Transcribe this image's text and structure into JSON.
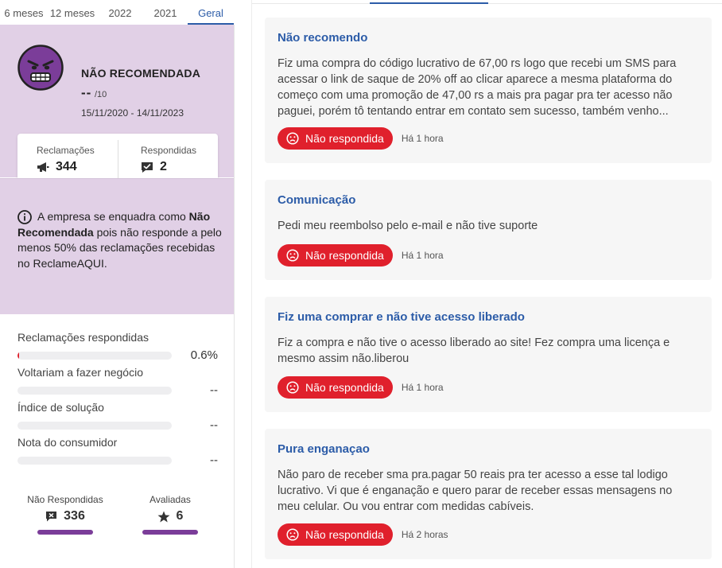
{
  "tabs": [
    "6 meses",
    "12 meses",
    "2022",
    "2021",
    "Geral"
  ],
  "status": {
    "title": "NÃO RECOMENDADA",
    "score": "--",
    "score_max": "/10",
    "period": "15/11/2020 - 14/11/2023"
  },
  "counts": {
    "reclamacoes_label": "Reclamações",
    "reclamacoes_value": "344",
    "respondidas_label": "Respondidas",
    "respondidas_value": "2"
  },
  "info": {
    "text_before": "A empresa se enquadra como ",
    "text_bold": "Não Recomendada",
    "text_after": " pois não responde a pelo menos 50% das reclamações recebidas no ReclameAQUI."
  },
  "metrics": [
    {
      "label": "Reclamações respondidas",
      "value": "0.6%",
      "fill": 0.006
    },
    {
      "label": "Voltariam a fazer negócio",
      "value": "--",
      "fill": 0
    },
    {
      "label": "Índice de solução",
      "value": "--",
      "fill": 0
    },
    {
      "label": "Nota do consumidor",
      "value": "--",
      "fill": 0
    }
  ],
  "bottom": {
    "nao_respondidas_label": "Não Respondidas",
    "nao_respondidas_value": "336",
    "avaliadas_label": "Avaliadas",
    "avaliadas_value": "6"
  },
  "complaints": [
    {
      "title": "Não recomendo",
      "body": "Fiz uma compra do código lucrativo de 67,00 rs logo que recebi um SMS para acessar o link de saque de 20% off ao clicar aparece a mesma plataforma do começo com uma promoção de 47,00 rs a mais pra pagar pra ter acesso não paguei, porém tô tentando entrar em contato sem sucesso, também venho...",
      "status": "Não respondida",
      "time": "Há 1 hora"
    },
    {
      "title": "Comunicação",
      "body": "Pedi meu reembolso pelo e-mail e não tive suporte",
      "status": "Não respondida",
      "time": "Há 1 hora"
    },
    {
      "title": "Fiz uma comprar e não tive acesso liberado",
      "body": "Fiz a compra e não tive o acesso liberado ao site! Fez compra uma licença e mesmo assim não.liberou",
      "status": "Não respondida",
      "time": "Há 1 hora"
    },
    {
      "title": "Pura enganaçao",
      "body": "Não paro de receber sma pra.pagar 50 reais pra ter acesso a esse tal lodigo lucrativo. Vi que é enganação e quero parar de receber essas mensagens no meu celular. Ou vou entrar com medidas cabíveis.",
      "status": "Não respondida",
      "time": "Há 2 horas"
    }
  ],
  "colors": {
    "accent": "#2c5ca8",
    "badge_red": "#e0202c",
    "panel_purple": "#e1d0e6",
    "bar_purple": "#7b3d99"
  }
}
